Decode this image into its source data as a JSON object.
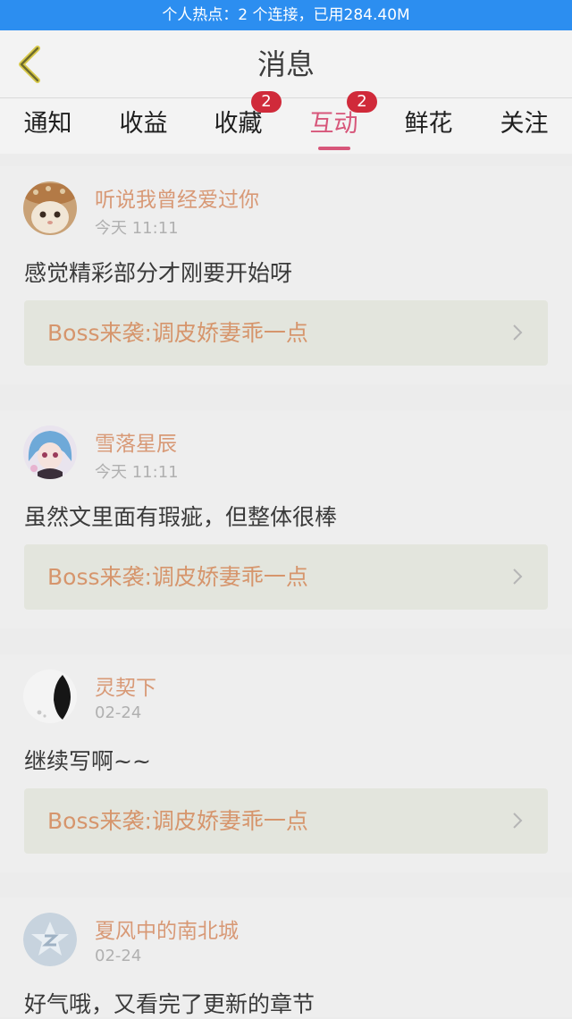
{
  "status_bar": {
    "text": "个人热点：2 个连接，已用284.40M"
  },
  "header": {
    "title": "消息",
    "back_icon": "chevron-left-icon"
  },
  "tabs": [
    {
      "label": "通知",
      "badge": null,
      "active": false
    },
    {
      "label": "收益",
      "badge": null,
      "active": false
    },
    {
      "label": "收藏",
      "badge": "2",
      "active": false
    },
    {
      "label": "互动",
      "badge": "2",
      "active": true
    },
    {
      "label": "鲜花",
      "badge": null,
      "active": false
    },
    {
      "label": "关注",
      "badge": null,
      "active": false
    }
  ],
  "colors": {
    "status_bar": "#2c8ef0",
    "accent": "#d7567a",
    "badge": "#d02a3a",
    "username": "#d89976",
    "book_title": "#d6956c",
    "book_link_bg": "#e3e5dd"
  },
  "messages": [
    {
      "username": "听说我曾经爱过你",
      "time": "今天 11:11",
      "comment": "感觉精彩部分才刚要开始呀",
      "book": "Boss来袭:调皮娇妻乖一点",
      "avatar": "kitten-avatar"
    },
    {
      "username": "雪落星辰",
      "time": "今天 11:11",
      "comment": "虽然文里面有瑕疵，但整体很棒",
      "book": "Boss来袭:调皮娇妻乖一点",
      "avatar": "anime-girl-avatar"
    },
    {
      "username": "灵契下",
      "time": "02-24",
      "comment": "继续写啊~~",
      "book": "Boss来袭:调皮娇妻乖一点",
      "avatar": "dark-figure-avatar"
    },
    {
      "username": "夏风中的南北城",
      "time": "02-24",
      "comment": "好气哦，又看完了更新的章节",
      "book": "",
      "avatar": "default-star-avatar"
    }
  ]
}
